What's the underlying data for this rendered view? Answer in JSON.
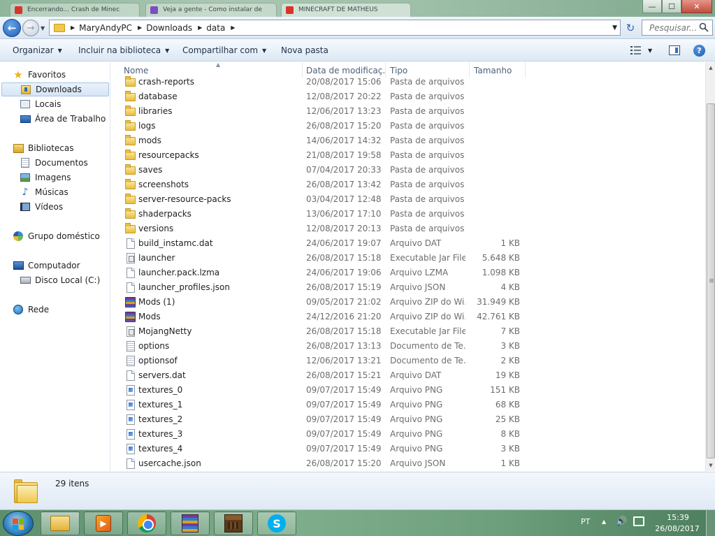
{
  "browser_tabs": [
    {
      "label": "Encerrando... Crash de Minec",
      "color": "#d9342b"
    },
    {
      "label": "Veja a gente - Como instalar de",
      "color": "#7a4fc1"
    },
    {
      "label": "MINECRAFT DE MATHEUS",
      "color": "#d9342b"
    }
  ],
  "window_controls": {
    "minimize": "—",
    "maximize": "☐",
    "close": "✕"
  },
  "address": {
    "crumbs": [
      "MaryAndyPC",
      "Downloads",
      "data"
    ],
    "search_placeholder": "Pesquisar..."
  },
  "toolbar": {
    "organize": "Organizar",
    "include_library": "Incluir na biblioteca",
    "share_with": "Compartilhar com",
    "new_folder": "Nova pasta"
  },
  "nav": {
    "favorites": "Favoritos",
    "downloads": "Downloads",
    "places": "Locais",
    "desktop": "Área de Trabalho",
    "libraries": "Bibliotecas",
    "documents": "Documentos",
    "images": "Imagens",
    "music": "Músicas",
    "videos": "Vídeos",
    "homegroup": "Grupo doméstico",
    "computer": "Computador",
    "local_disk": "Disco Local (C:)",
    "network": "Rede"
  },
  "columns": {
    "name": "Nome",
    "date": "Data de modificaç...",
    "type": "Tipo",
    "size": "Tamanho"
  },
  "files": [
    {
      "name": "crash-reports",
      "date": "20/08/2017 15:06",
      "type": "Pasta de arquivos",
      "size": "",
      "icon": "folder-icon"
    },
    {
      "name": "database",
      "date": "12/08/2017 20:22",
      "type": "Pasta de arquivos",
      "size": "",
      "icon": "folder-icon"
    },
    {
      "name": "libraries",
      "date": "12/06/2017 13:23",
      "type": "Pasta de arquivos",
      "size": "",
      "icon": "folder-icon"
    },
    {
      "name": "logs",
      "date": "26/08/2017 15:20",
      "type": "Pasta de arquivos",
      "size": "",
      "icon": "folder-icon"
    },
    {
      "name": "mods",
      "date": "14/06/2017 14:32",
      "type": "Pasta de arquivos",
      "size": "",
      "icon": "folder-icon"
    },
    {
      "name": "resourcepacks",
      "date": "21/08/2017 19:58",
      "type": "Pasta de arquivos",
      "size": "",
      "icon": "folder-icon"
    },
    {
      "name": "saves",
      "date": "07/04/2017 20:33",
      "type": "Pasta de arquivos",
      "size": "",
      "icon": "folder-icon"
    },
    {
      "name": "screenshots",
      "date": "26/08/2017 13:42",
      "type": "Pasta de arquivos",
      "size": "",
      "icon": "folder-icon"
    },
    {
      "name": "server-resource-packs",
      "date": "03/04/2017 12:48",
      "type": "Pasta de arquivos",
      "size": "",
      "icon": "folder-icon"
    },
    {
      "name": "shaderpacks",
      "date": "13/06/2017 17:10",
      "type": "Pasta de arquivos",
      "size": "",
      "icon": "folder-icon"
    },
    {
      "name": "versions",
      "date": "12/08/2017 20:13",
      "type": "Pasta de arquivos",
      "size": "",
      "icon": "folder-icon"
    },
    {
      "name": "build_instamc.dat",
      "date": "24/06/2017 19:07",
      "type": "Arquivo DAT",
      "size": "1 KB",
      "icon": "file-icon"
    },
    {
      "name": "launcher",
      "date": "26/08/2017 15:18",
      "type": "Executable Jar File",
      "size": "5.648 KB",
      "icon": "jar-file-icon"
    },
    {
      "name": "launcher.pack.lzma",
      "date": "24/06/2017 19:06",
      "type": "Arquivo LZMA",
      "size": "1.098 KB",
      "icon": "file-icon"
    },
    {
      "name": "launcher_profiles.json",
      "date": "26/08/2017 15:19",
      "type": "Arquivo JSON",
      "size": "4 KB",
      "icon": "file-icon"
    },
    {
      "name": "Mods (1)",
      "date": "09/05/2017 21:02",
      "type": "Arquivo ZIP do Wi...",
      "size": "31.949 KB",
      "icon": "winrar-archive-icon"
    },
    {
      "name": "Mods",
      "date": "24/12/2016 21:20",
      "type": "Arquivo ZIP do Wi...",
      "size": "42.761 KB",
      "icon": "winrar-archive-icon"
    },
    {
      "name": "MojangNetty",
      "date": "26/08/2017 15:18",
      "type": "Executable Jar File",
      "size": "7 KB",
      "icon": "jar-file-icon"
    },
    {
      "name": "options",
      "date": "26/08/2017 13:13",
      "type": "Documento de Te...",
      "size": "3 KB",
      "icon": "text-file-icon"
    },
    {
      "name": "optionsof",
      "date": "12/06/2017 13:21",
      "type": "Documento de Te...",
      "size": "2 KB",
      "icon": "text-file-icon"
    },
    {
      "name": "servers.dat",
      "date": "26/08/2017 15:21",
      "type": "Arquivo DAT",
      "size": "19 KB",
      "icon": "file-icon"
    },
    {
      "name": "textures_0",
      "date": "09/07/2017 15:49",
      "type": "Arquivo PNG",
      "size": "151 KB",
      "icon": "png-file-icon"
    },
    {
      "name": "textures_1",
      "date": "09/07/2017 15:49",
      "type": "Arquivo PNG",
      "size": "68 KB",
      "icon": "png-file-icon"
    },
    {
      "name": "textures_2",
      "date": "09/07/2017 15:49",
      "type": "Arquivo PNG",
      "size": "25 KB",
      "icon": "png-file-icon"
    },
    {
      "name": "textures_3",
      "date": "09/07/2017 15:49",
      "type": "Arquivo PNG",
      "size": "8 KB",
      "icon": "png-file-icon"
    },
    {
      "name": "textures_4",
      "date": "09/07/2017 15:49",
      "type": "Arquivo PNG",
      "size": "3 KB",
      "icon": "png-file-icon"
    },
    {
      "name": "usercache.json",
      "date": "26/08/2017 15:20",
      "type": "Arquivo JSON",
      "size": "1 KB",
      "icon": "file-icon"
    }
  ],
  "details": {
    "item_count": "29 itens"
  },
  "taskbar": {
    "apps": [
      "windows-explorer-icon",
      "media-player-icon",
      "chrome-icon",
      "winrar-icon",
      "minecraft-icon",
      "skype-icon"
    ],
    "language": "PT",
    "time": "15:39",
    "date": "26/08/2017"
  },
  "colors": {
    "accent": "#1b5fb8",
    "selection": "#d5e5f7",
    "folder": "#e9bd3d"
  }
}
